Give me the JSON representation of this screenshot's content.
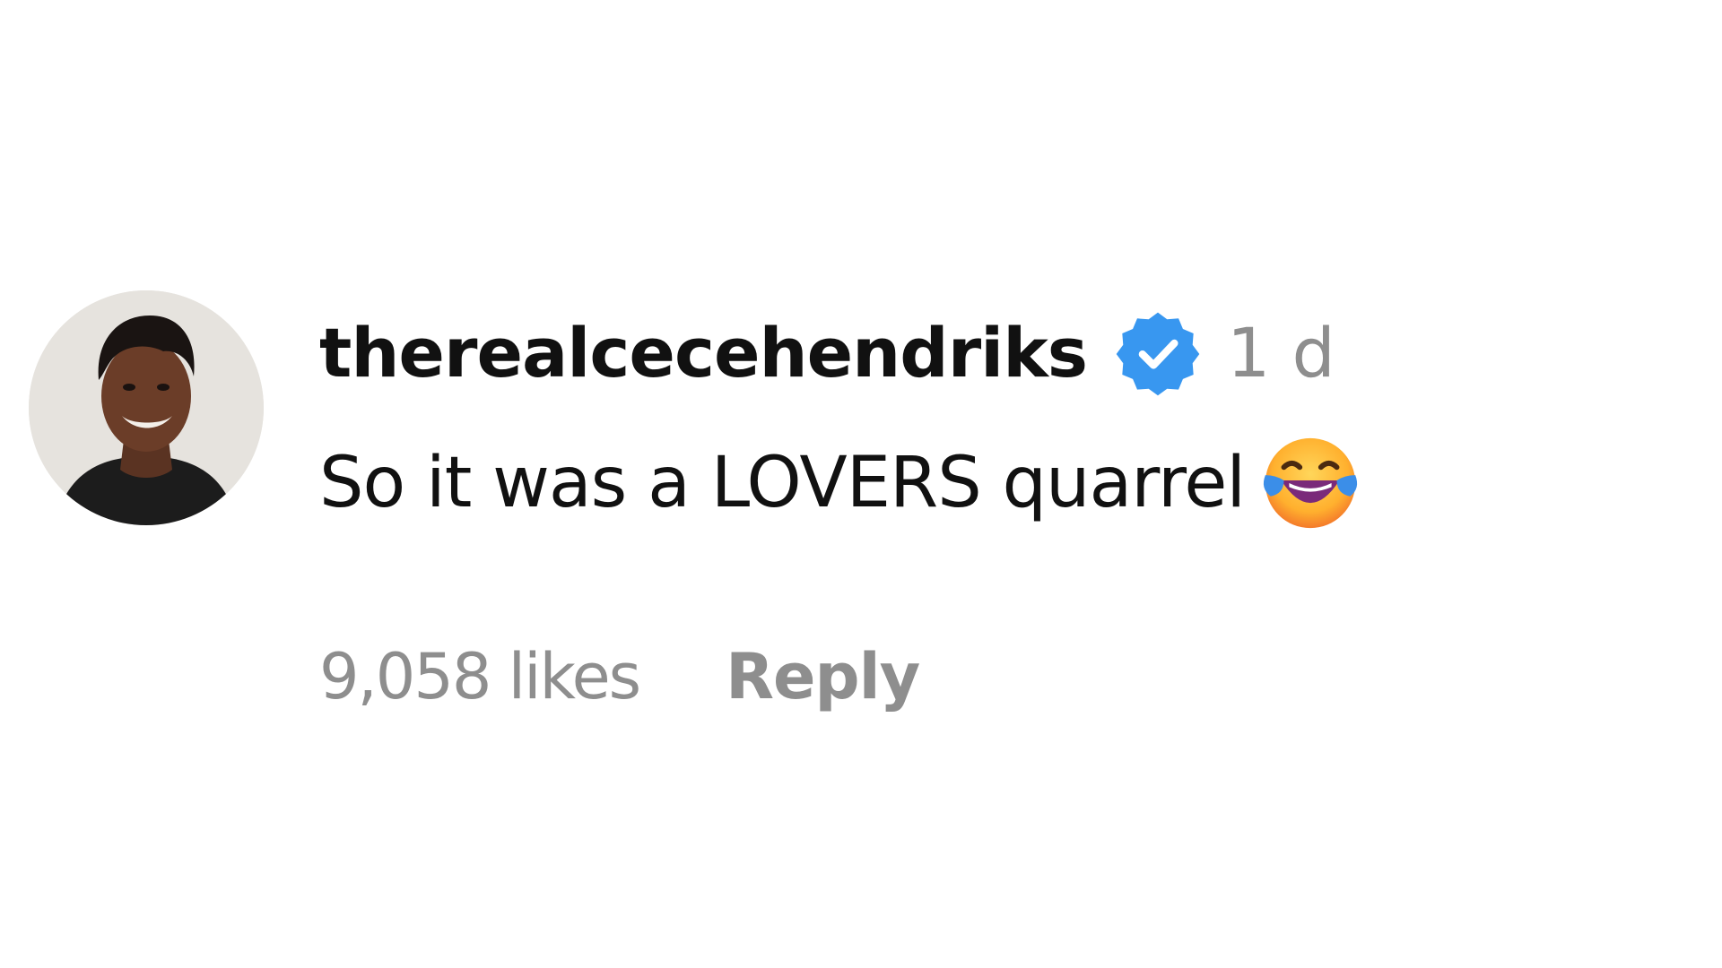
{
  "comment": {
    "avatar_icon": "profile-photo",
    "username": "therealcecehendriks",
    "verified_icon": "verified-badge-icon",
    "verified_color": "#3897f0",
    "timestamp": "1 d",
    "text": "So it was a LOVERS quarrel",
    "emoji_icon": "face-with-tears-of-joy-icon",
    "likes": "9,058 likes",
    "reply_label": "Reply"
  },
  "colors": {
    "text_primary": "#111111",
    "text_secondary": "#8e8e8e",
    "background": "#ffffff"
  }
}
